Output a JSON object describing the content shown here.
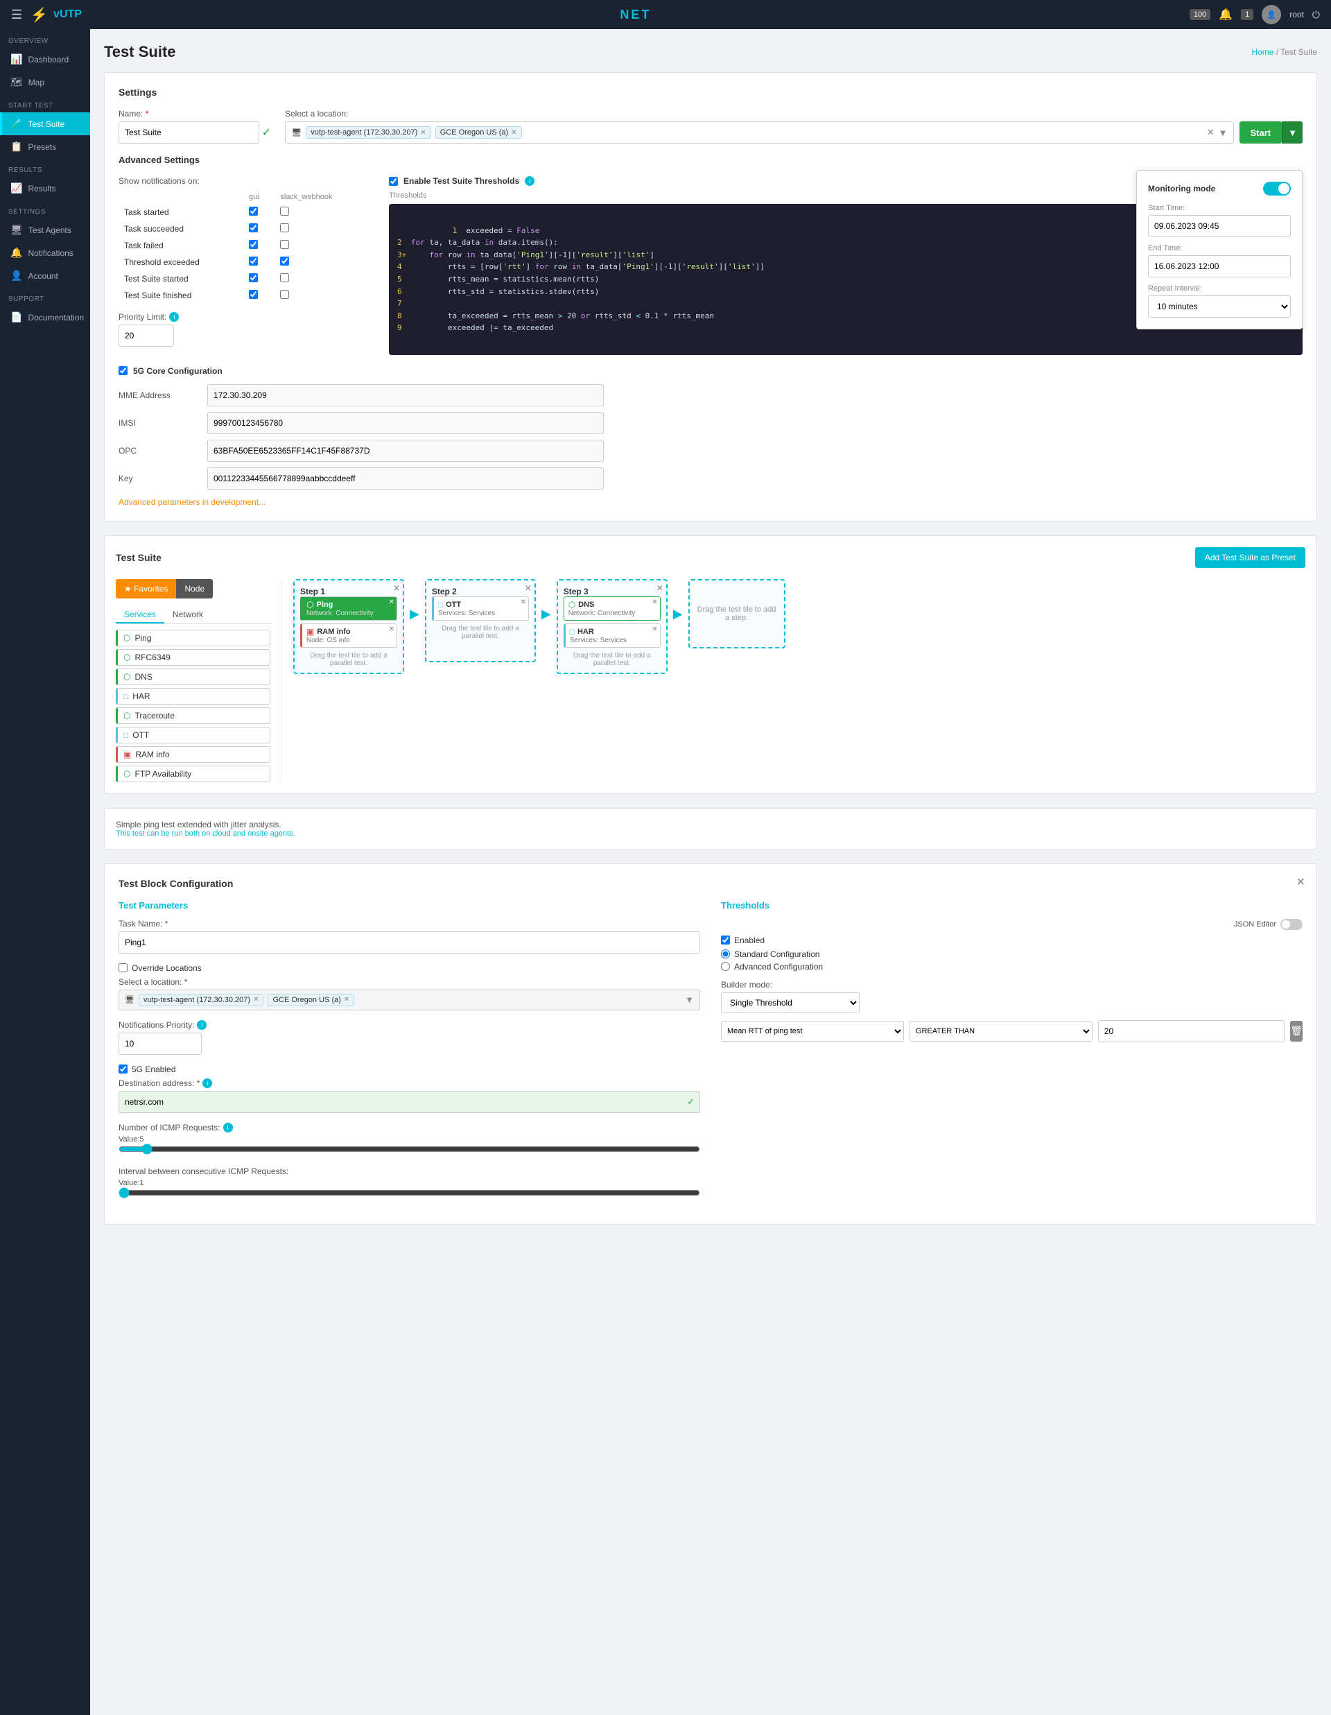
{
  "app": {
    "name": "vUTP",
    "logo_text": "NET"
  },
  "topnav": {
    "badge_count": "100",
    "notification_count": "1",
    "user": "root",
    "hamburger_label": "☰"
  },
  "breadcrumb": {
    "home": "Home",
    "separator": "/",
    "current": "Test Suite"
  },
  "page_title": "Test Suite",
  "sidebar": {
    "sections": [
      {
        "label": "OVERVIEW",
        "items": [
          {
            "id": "dashboard",
            "label": "Dashboard",
            "icon": "📊"
          },
          {
            "id": "map",
            "label": "Map",
            "icon": "🗺"
          }
        ]
      },
      {
        "label": "START TEST",
        "items": [
          {
            "id": "test-suite",
            "label": "Test Suite",
            "icon": "🧪",
            "active": true
          },
          {
            "id": "presets",
            "label": "Presets",
            "icon": "📋"
          }
        ]
      },
      {
        "label": "RESULTS",
        "items": [
          {
            "id": "results",
            "label": "Results",
            "icon": "📈"
          }
        ]
      },
      {
        "label": "SETTINGS",
        "items": [
          {
            "id": "test-agents",
            "label": "Test Agents",
            "icon": "🖥"
          },
          {
            "id": "notifications",
            "label": "Notifications",
            "icon": "🔔"
          },
          {
            "id": "account",
            "label": "Account",
            "icon": "👤"
          }
        ]
      },
      {
        "label": "SUPPORT",
        "items": [
          {
            "id": "documentation",
            "label": "Documentation",
            "icon": "📄"
          }
        ]
      }
    ]
  },
  "settings": {
    "section_title": "Settings",
    "name_label": "Name:",
    "name_value": "Test Suite",
    "location_label": "Select a location:",
    "location_tags": [
      {
        "label": "vutp-test-agent (172.30.30.207)"
      },
      {
        "label": "GCE Oregon US (a)"
      }
    ],
    "start_button": "Start"
  },
  "monitoring_popup": {
    "title": "Monitoring mode",
    "start_time_label": "Start Time:",
    "start_time_value": "09.06.2023 09:45",
    "end_time_label": "End Time:",
    "end_time_value": "16.06.2023 12:00",
    "repeat_label": "Repeat Interval:",
    "repeat_value": "10 minutes"
  },
  "advanced_settings": {
    "title": "Advanced Settings",
    "notifications_label": "Show notifications on:",
    "col_gui": "gui",
    "col_slack": "slack_webhook",
    "rows": [
      {
        "label": "Task started",
        "gui": true,
        "slack": false
      },
      {
        "label": "Task succeeded",
        "gui": true,
        "slack": false
      },
      {
        "label": "Task failed",
        "gui": true,
        "slack": false
      },
      {
        "label": "Threshold exceeded",
        "gui": true,
        "slack": true
      },
      {
        "label": "Test Suite started",
        "gui": true,
        "slack": false
      },
      {
        "label": "Test Suite finished",
        "gui": true,
        "slack": false
      }
    ],
    "priority_label": "Priority Limit:",
    "priority_value": "20",
    "threshold_title": "Enable Test Suite Thresholds",
    "threshold_code_lines": [
      "1  exceeded = False",
      "2  for ta, ta_data in data.items():",
      "3+     for row in ta_data['Ping1'][-1]['result']['list']",
      "4          rtts = [row['rtt'] for row in ta_data['Ping1'][-1]['result']['list']]",
      "5          rtts_mean = statistics.mean(rtts)",
      "6          rtts_std = statistics.stdev(rtts)",
      "7",
      "8          ta_exceeded = rtts_mean > 20 or rtts_std < 0.1 * rtts_mean",
      "9          exceeded |= ta_exceeded"
    ],
    "five_g_title": "5G Core Configuration",
    "mme_label": "MME Address",
    "mme_value": "172.30.30.209",
    "imsi_label": "IMSI",
    "imsi_value": "999700123456780",
    "opc_label": "OPC",
    "opc_value": "63BFA50EE6523365FF14C1F45F88737D",
    "key_label": "Key",
    "key_value": "00112233445566778899aabbccddeeff",
    "advanced_dev_link": "Advanced parameters in development..."
  },
  "test_suite_panel": {
    "title": "Test Suite",
    "add_preset_btn": "Add Test Suite as Preset",
    "favorites_btn": "★ Favorites",
    "node_btn": "Node",
    "tab_services": "Services",
    "tab_network": "Network",
    "tiles": [
      {
        "id": "ping",
        "label": "Ping",
        "type": "ping"
      },
      {
        "id": "rfc6349",
        "label": "RFC6349",
        "type": "rfc"
      },
      {
        "id": "dns",
        "label": "DNS",
        "type": "dns"
      },
      {
        "id": "har",
        "label": "HAR",
        "type": "har"
      },
      {
        "id": "traceroute",
        "label": "Traceroute",
        "type": "traceroute"
      },
      {
        "id": "ott",
        "label": "OTT",
        "type": "ott"
      },
      {
        "id": "ram-info",
        "label": "RAM info",
        "type": "ram"
      },
      {
        "id": "ftp",
        "label": "FTP Availability",
        "type": "ftp"
      }
    ],
    "steps": [
      {
        "label": "Step 1",
        "blocks": [
          {
            "name": "Ping",
            "sub": "Network: Connectivity",
            "color": "green"
          },
          {
            "name": "RAM info",
            "sub": "Node: OS info",
            "color": "ram"
          }
        ],
        "add_parallel": "Drag the test tile to add a parallel test."
      },
      {
        "label": "Step 2",
        "blocks": [
          {
            "name": "OTT",
            "sub": "Services: Services",
            "color": "blue"
          }
        ],
        "add_parallel": "Drag the test tile to add a parallel test."
      },
      {
        "label": "Step 3",
        "blocks": [
          {
            "name": "DNS",
            "sub": "Network: Connectivity",
            "color": "green-outline"
          },
          {
            "name": "HAR",
            "sub": "Services: Services",
            "color": "blue"
          }
        ],
        "add_parallel": "Drag the test tile to add a parallel test."
      }
    ],
    "empty_step_text": "Drag the test tile to add a step."
  },
  "ping_info": {
    "description": "Simple ping test extended with jitter analysis.",
    "link": "This test can be run both on cloud and onsite agents."
  },
  "test_block_config": {
    "title": "Test Block Configuration",
    "params_title": "Test Parameters",
    "task_name_label": "Task Name: *",
    "task_name_value": "Ping1",
    "override_locations_label": "Override Locations",
    "select_location_label": "Select a location: *",
    "location_tags": [
      {
        "label": "vutp-test-agent (172.30.30.207)"
      },
      {
        "label": "GCE Oregon US (a)"
      }
    ],
    "notif_priority_label": "Notifications Priority:",
    "notif_priority_value": "10",
    "five_g_enabled_label": "5G Enabled",
    "destination_label": "Destination address: *",
    "destination_value": "netrsr.com",
    "icmp_requests_label": "Number of ICMP Requests:",
    "icmp_value": 5,
    "icmp_interval_label": "Interval between consecutive ICMP Requests:",
    "icmp_interval_value": 1,
    "thresholds_title": "Thresholds",
    "enabled_label": "Enabled",
    "standard_config_label": "Standard Configuration",
    "advanced_config_label": "Advanced Configuration",
    "builder_mode_label": "Builder mode:",
    "builder_mode_value": "Single Threshold",
    "json_editor_label": "JSON Editor",
    "metric_label": "Mean RTT of ping test",
    "operator_label": "GREATER THAN",
    "threshold_num": "20",
    "delete_btn": "🗑"
  }
}
